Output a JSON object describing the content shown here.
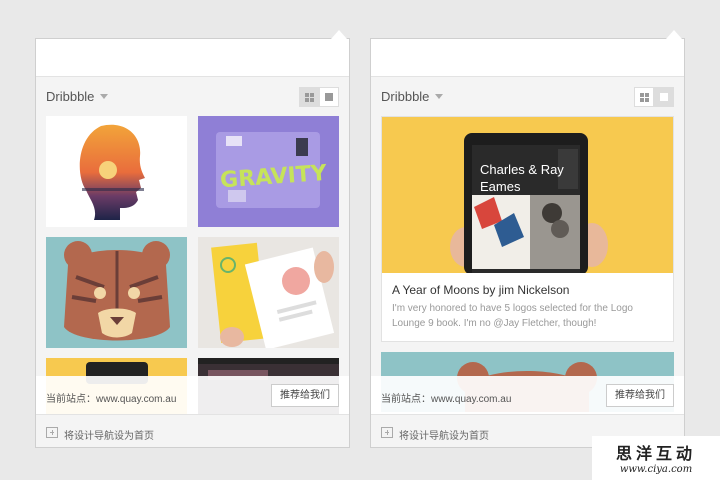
{
  "panels": [
    {
      "source_label": "Dribbble",
      "view_modes": [
        "grid-view-icon",
        "single-view-icon"
      ],
      "active_view": "grid",
      "tiles": [
        "portrait-sunset",
        "gravity-poster",
        "tiger-illustration",
        "brochure-photo",
        "partial-tile-yellow",
        "partial-tile-dark"
      ],
      "footer": {
        "current_site": "当前站点：www.quay.com.au",
        "recommend_button": "推荐给我们"
      },
      "set_home": "将设计导航设为首页"
    },
    {
      "source_label": "Dribbble",
      "view_modes": [
        "grid-view-icon",
        "single-view-icon"
      ],
      "active_view": "single",
      "card": {
        "image_text_line1": "Charles & Ray",
        "image_text_line2": "Eames",
        "title": "A Year of Moons by jim Nickelson",
        "description": "I'm very honored to have 5 logos selected for the Logo Lounge 9 book. I'm no @Jay Fletcher, though!"
      },
      "footer": {
        "current_site": "当前站点：www.quay.com.au",
        "recommend_button": "推荐给我们"
      },
      "set_home": "将设计导航设为首页"
    }
  ],
  "watermark": {
    "line1": "思洋互动",
    "line2": "www.ciya.com"
  },
  "colors": {
    "panel_bg": "#f4f4f4",
    "card_yellow": "#f7c94f",
    "gravity_purple": "#8f7fd6",
    "tiger_teal": "#8ec3c6",
    "tiger_brown": "#b3684e"
  }
}
